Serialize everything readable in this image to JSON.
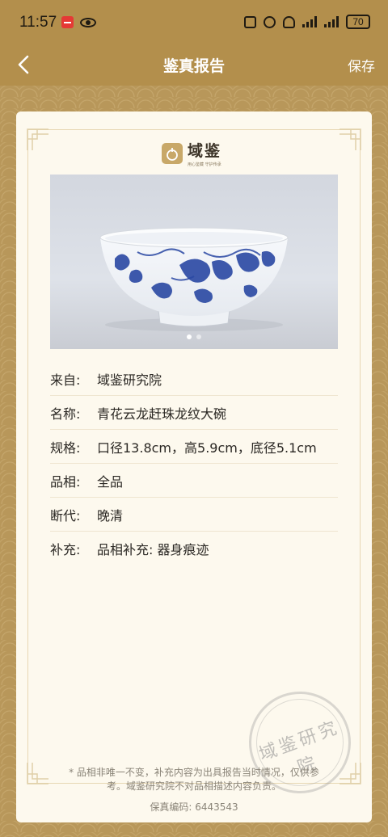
{
  "status_bar": {
    "time": "11:57",
    "battery": "70"
  },
  "nav": {
    "title": "鉴真报告",
    "save_label": "保存"
  },
  "logo": {
    "name": "域鉴",
    "tagline": "用心鉴藏 守护传承"
  },
  "photo": {
    "alt": "青花云龙赶珠龙纹大碗",
    "dots": 2,
    "active_dot": 1
  },
  "info": [
    {
      "label": "来自:",
      "value": "域鉴研究院"
    },
    {
      "label": "名称:",
      "value": "青花云龙赶珠龙纹大碗"
    },
    {
      "label": "规格:",
      "value": "口径13.8cm，高5.9cm，底径5.1cm"
    },
    {
      "label": "品相:",
      "value": "全品"
    },
    {
      "label": "断代:",
      "value": "晚清"
    },
    {
      "label": "补充:",
      "value": "品相补充:  器身痕迹"
    }
  ],
  "stamp_text": "域鉴研究院",
  "disclaimer": "* 品相非唯一不变，补充内容为出具报告当时情况，仅供参考。域鉴研究院不对品相描述内容负责。",
  "serial": "保真编码:  6443543"
}
